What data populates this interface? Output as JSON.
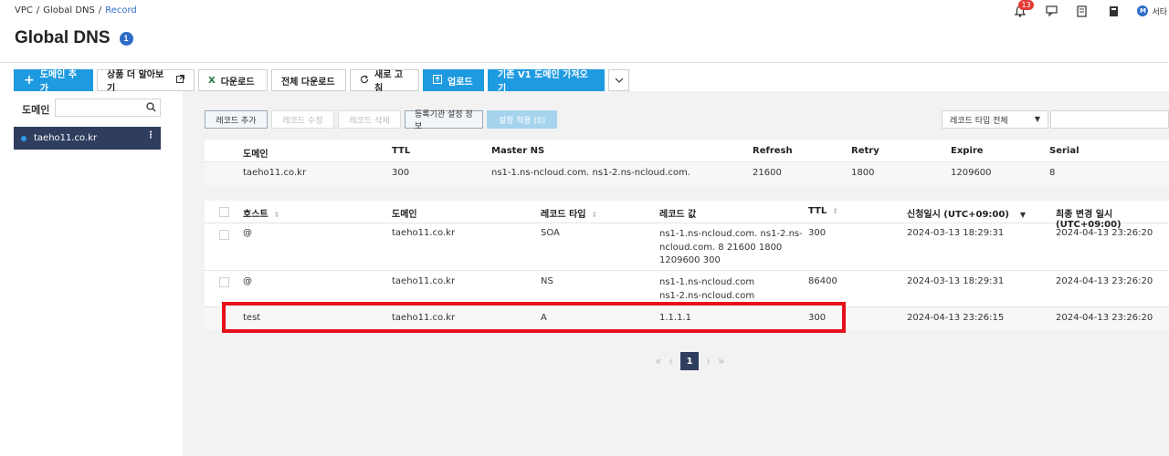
{
  "breadcrumb": {
    "items": [
      "VPC",
      "Global DNS",
      "Record"
    ]
  },
  "header": {
    "notification_count": "13",
    "user_initial": "M",
    "user_label": "서타"
  },
  "page": {
    "title": "Global DNS",
    "info_badge": "1"
  },
  "toolbar": {
    "add_domain": "도메인 추가",
    "learn_more": "상품 더 알아보기",
    "download": "다운로드",
    "download_all": "전체 다운로드",
    "refresh": "새로 고침",
    "upload": "업로드",
    "import_v1": "기존 V1 도메인 가져오기"
  },
  "sidebar": {
    "label": "도메인",
    "search_placeholder": "",
    "domains": [
      {
        "name": "taeho11.co.kr",
        "status_color": "#2d9be3"
      }
    ]
  },
  "record_toolbar": {
    "add": "레코드 추가",
    "edit": "레코드 수정",
    "delete": "레코드 삭제",
    "registrar": "등록기관 설정 정보",
    "apply": "설정 적용 (0)",
    "type_filter": "레코드 타입 전체"
  },
  "soa_table": {
    "headers": [
      "도메인",
      "TTL",
      "Master NS",
      "Refresh",
      "Retry",
      "Expire",
      "Serial"
    ],
    "row": [
      "taeho11.co.kr",
      "300",
      "ns1-1.ns-ncloud.com. ns1-2.ns-ncloud.com.",
      "21600",
      "1800",
      "1209600",
      "8"
    ]
  },
  "record_table": {
    "headers": [
      "호스트",
      "도메인",
      "레코드 타입",
      "레코드 값",
      "TTL",
      "신청일시 (UTC+09:00)",
      "최종 변경 일시 (UTC+09:00)"
    ],
    "rows": [
      {
        "host": "@",
        "domain": "taeho11.co.kr",
        "type": "SOA",
        "value": [
          "ns1-1.ns-ncloud.com. ns1-2.ns-",
          "ncloud.com. 8 21600 1800",
          "1209600 300"
        ],
        "ttl": "300",
        "created": "2024-03-13 18:29:31",
        "modified": "2024-04-13 23:26:20"
      },
      {
        "host": "@",
        "domain": "taeho11.co.kr",
        "type": "NS",
        "value": [
          "ns1-1.ns-ncloud.com",
          "ns1-2.ns-ncloud.com"
        ],
        "ttl": "86400",
        "created": "2024-03-13 18:29:31",
        "modified": "2024-04-13 23:26:20"
      },
      {
        "host": "test",
        "domain": "taeho11.co.kr",
        "type": "A",
        "value": [
          "1.1.1.1"
        ],
        "ttl": "300",
        "created": "2024-04-13 23:26:15",
        "modified": "2024-04-13 23:26:20"
      }
    ]
  },
  "pagination": {
    "current": "1"
  },
  "colors": {
    "primary": "#1e9be0",
    "nav_dark": "#2f3d5e",
    "highlight": "#e6101a"
  }
}
